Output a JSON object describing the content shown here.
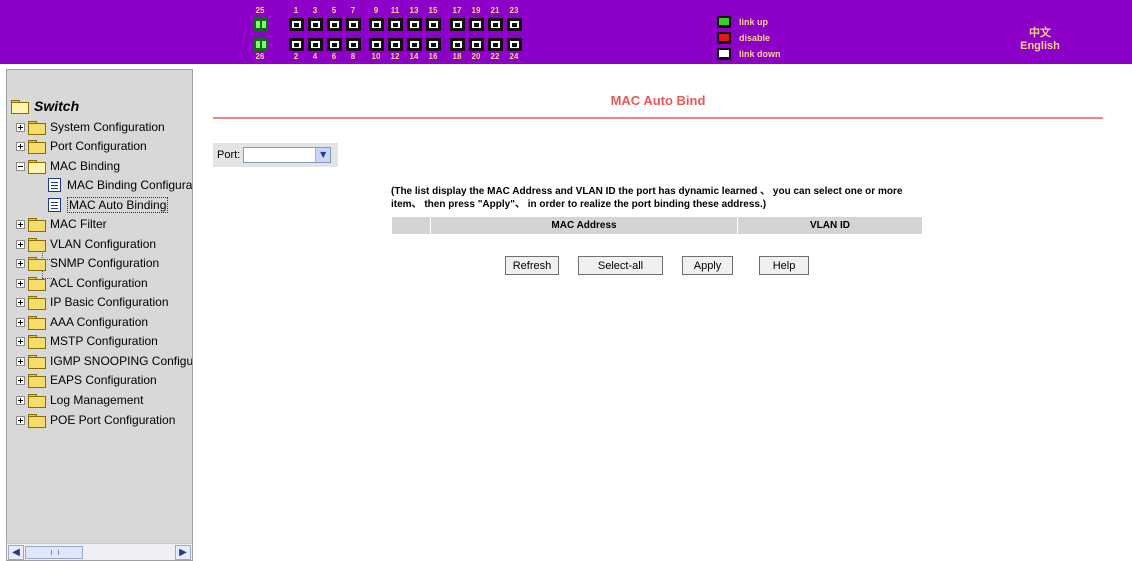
{
  "header": {
    "ports_top_odd": [
      "1",
      "3",
      "5",
      "7",
      "9",
      "11",
      "13",
      "15",
      "17",
      "19",
      "21",
      "23"
    ],
    "ports_bottom_even": [
      "2",
      "4",
      "6",
      "8",
      "10",
      "12",
      "14",
      "16",
      "18",
      "20",
      "22",
      "24"
    ],
    "uplink_top": "25",
    "uplink_bottom": "26",
    "legend": [
      {
        "label": "link up",
        "color": "#3ccf2a"
      },
      {
        "label": "disable",
        "color": "#e01818"
      },
      {
        "label": "link down",
        "color": "#ffffff"
      }
    ],
    "lang_chinese": "中文",
    "lang_english": "English",
    "banner_color": "#8c00c8"
  },
  "sidebar": {
    "root": "Switch",
    "items": [
      {
        "label": "System Configuration"
      },
      {
        "label": "Port Configuration"
      },
      {
        "label": "MAC Binding"
      },
      {
        "label": "MAC Binding Configuratic"
      },
      {
        "label": "MAC Auto Binding"
      },
      {
        "label": "MAC Filter"
      },
      {
        "label": "VLAN Configuration"
      },
      {
        "label": "SNMP Configuration"
      },
      {
        "label": "ACL Configuration"
      },
      {
        "label": "IP Basic Configuration"
      },
      {
        "label": "AAA Configuration"
      },
      {
        "label": "MSTP Configuration"
      },
      {
        "label": "IGMP SNOOPING Configura"
      },
      {
        "label": "EAPS Configuration"
      },
      {
        "label": "Log Management"
      },
      {
        "label": "POE Port Configuration"
      }
    ]
  },
  "main": {
    "title": "MAC Auto Bind",
    "title_color": "#e45a5a",
    "port_label": "Port:",
    "port_value": "",
    "note": "(The list display the MAC Address and VLAN ID the port has dynamic learned 、 you can select one or more item、 then press \"Apply\"、 in order to realize the port binding these address.)",
    "table_headers": [
      "",
      "MAC Address",
      "VLAN ID"
    ],
    "buttons": {
      "refresh": "Refresh",
      "select_all": "Select-all",
      "apply": "Apply",
      "help": "Help"
    }
  }
}
